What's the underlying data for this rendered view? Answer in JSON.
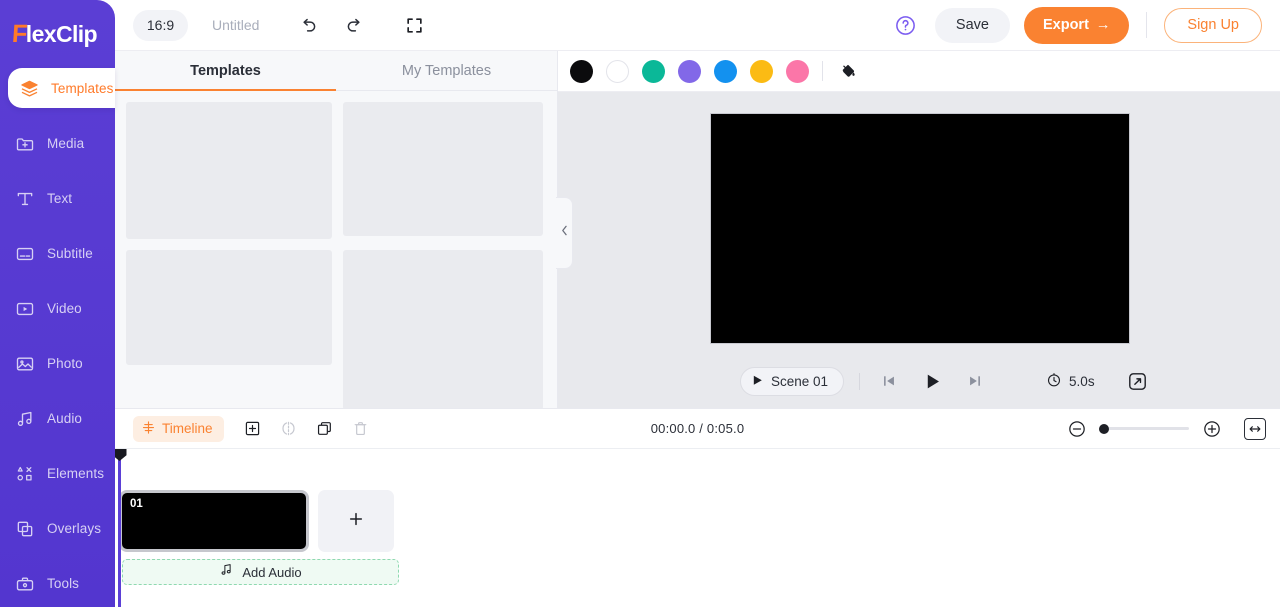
{
  "app": {
    "name": "FlexClip",
    "logo_first": "F",
    "logo_rest": "lexClip"
  },
  "sidebar": {
    "items": [
      {
        "label": "Templates",
        "icon": "layers-icon",
        "active": true
      },
      {
        "label": "Media",
        "icon": "media-folder-icon",
        "active": false
      },
      {
        "label": "Text",
        "icon": "text-icon",
        "active": false
      },
      {
        "label": "Subtitle",
        "icon": "subtitle-icon",
        "active": false
      },
      {
        "label": "Video",
        "icon": "video-icon",
        "active": false
      },
      {
        "label": "Photo",
        "icon": "photo-icon",
        "active": false
      },
      {
        "label": "Audio",
        "icon": "audio-note-icon",
        "active": false
      },
      {
        "label": "Elements",
        "icon": "elements-shapes-icon",
        "active": false
      },
      {
        "label": "Overlays",
        "icon": "overlays-icon",
        "active": false
      },
      {
        "label": "Tools",
        "icon": "toolbox-icon",
        "active": false
      }
    ]
  },
  "topbar": {
    "aspect_ratio": "16:9",
    "project_title": "Untitled",
    "undo_icon": "undo-icon",
    "redo_icon": "redo-icon",
    "fullscreen_icon": "fullscreen-icon",
    "help_icon": "help-circle-icon",
    "save_label": "Save",
    "export_label": "Export",
    "export_arrow": "→",
    "signup_label": "Sign Up",
    "accent_orange": "#fa8231",
    "brand_purple": "#5b3fd6"
  },
  "panel": {
    "tabs": [
      {
        "label": "Templates",
        "active": true
      },
      {
        "label": "My Templates",
        "active": false
      }
    ],
    "collapse_icon": "chevron-left-icon",
    "placeholder_count": 6
  },
  "color_swatches": [
    {
      "name": "black",
      "hex": "#0b0b0d"
    },
    {
      "name": "white",
      "hex": "#ffffff"
    },
    {
      "name": "teal",
      "hex": "#0bb898"
    },
    {
      "name": "purple",
      "hex": "#8268e8"
    },
    {
      "name": "blue",
      "hex": "#1391ef"
    },
    {
      "name": "yellow",
      "hex": "#fbbb14"
    },
    {
      "name": "pink",
      "hex": "#fb76a8"
    }
  ],
  "fill_tool": {
    "icon": "paint-bucket-icon"
  },
  "preview": {
    "scene_label": "Scene 01",
    "scene_play_icon": "play-small-icon",
    "prev_icon": "skip-previous-icon",
    "play_icon": "play-icon",
    "next_icon": "skip-next-icon",
    "clock_icon": "clock-icon",
    "duration": "5.0s",
    "expand_icon": "expand-icon",
    "canvas_color": "#000000"
  },
  "timeline_toolbar": {
    "timeline_label": "Timeline",
    "timeline_icon": "timeline-icon",
    "add_icon": "add-box-icon",
    "split_icon": "split-icon",
    "duplicate_icon": "duplicate-icon",
    "delete_icon": "trash-icon",
    "time_display": "00:00.0 / 0:05.0",
    "zoom_out_icon": "zoom-out-icon",
    "zoom_in_icon": "zoom-in-icon",
    "fit_icon": "fit-width-icon",
    "zoom_value": 0
  },
  "timeline": {
    "clips": [
      {
        "number": "01",
        "selected": true
      }
    ],
    "add_scene_icon": "plus-icon",
    "add_audio_label": "Add Audio",
    "add_audio_icon": "music-note-icon",
    "playhead_position": "00:00.0"
  }
}
